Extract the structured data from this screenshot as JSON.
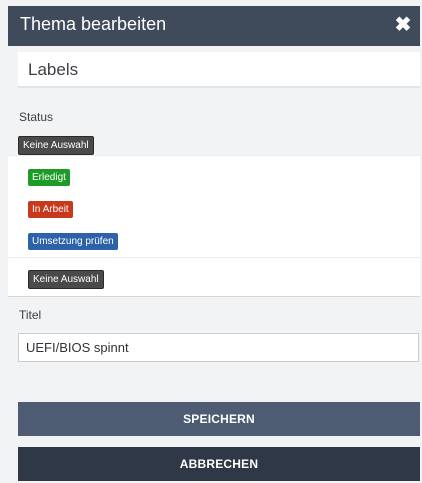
{
  "dialog": {
    "title": "Thema bearbeiten",
    "close_glyph": "✖",
    "close_icon": "close-icon"
  },
  "labels_section": {
    "heading": "Labels"
  },
  "status": {
    "label": "Status",
    "current_value": "Keine Auswahl",
    "options": [
      {
        "label": "Erledigt",
        "color": "#1c9b27"
      },
      {
        "label": "In Arbeit",
        "color": "#c8381c"
      },
      {
        "label": "Umsetzung prüfen",
        "color": "#2e62a8"
      },
      {
        "label": "Keine Auswahl",
        "color": "#4a4a4a"
      }
    ]
  },
  "titel": {
    "label": "Titel",
    "value": "UEFI/BIOS spinnt"
  },
  "buttons": {
    "save_label": "SPEICHERN",
    "cancel_label": "ABBRECHEN"
  },
  "colors": {
    "header_bg": "#3f4a5a",
    "save_bg": "#4d5c73",
    "cancel_bg": "#2e3846"
  }
}
